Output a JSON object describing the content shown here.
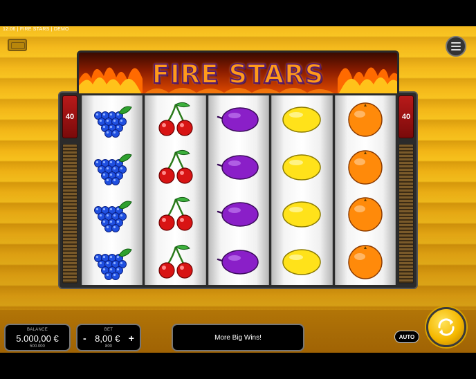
{
  "game": {
    "status_line": "12:06 | FIRE STARS | DEMO",
    "logo_title": "FIRE STARS"
  },
  "lines": {
    "left_count": "40",
    "right_count": "40"
  },
  "reels": [
    [
      "grapes",
      "grapes",
      "grapes",
      "grapes"
    ],
    [
      "cherry",
      "cherry",
      "cherry",
      "cherry"
    ],
    [
      "plum",
      "plum",
      "plum",
      "plum"
    ],
    [
      "lemon",
      "lemon",
      "lemon",
      "lemon"
    ],
    [
      "orange",
      "orange",
      "orange",
      "orange"
    ]
  ],
  "balance": {
    "label": "BALANCE",
    "value": "5.000,00 €",
    "sub": "500.000"
  },
  "bet": {
    "label": "BET",
    "minus": "-",
    "value": "8,00 €",
    "plus": "+",
    "sub": "800"
  },
  "message": "More Big Wins!",
  "controls": {
    "auto_label": "AUTO",
    "spin_icon": "spin-arrows-icon",
    "menu_icon": "hamburger-menu-icon",
    "chip_icon": "chip-icon"
  },
  "colors": {
    "background": "#f2b416",
    "line_marker": "#b81a1a",
    "spin_button": "#f5b800"
  }
}
